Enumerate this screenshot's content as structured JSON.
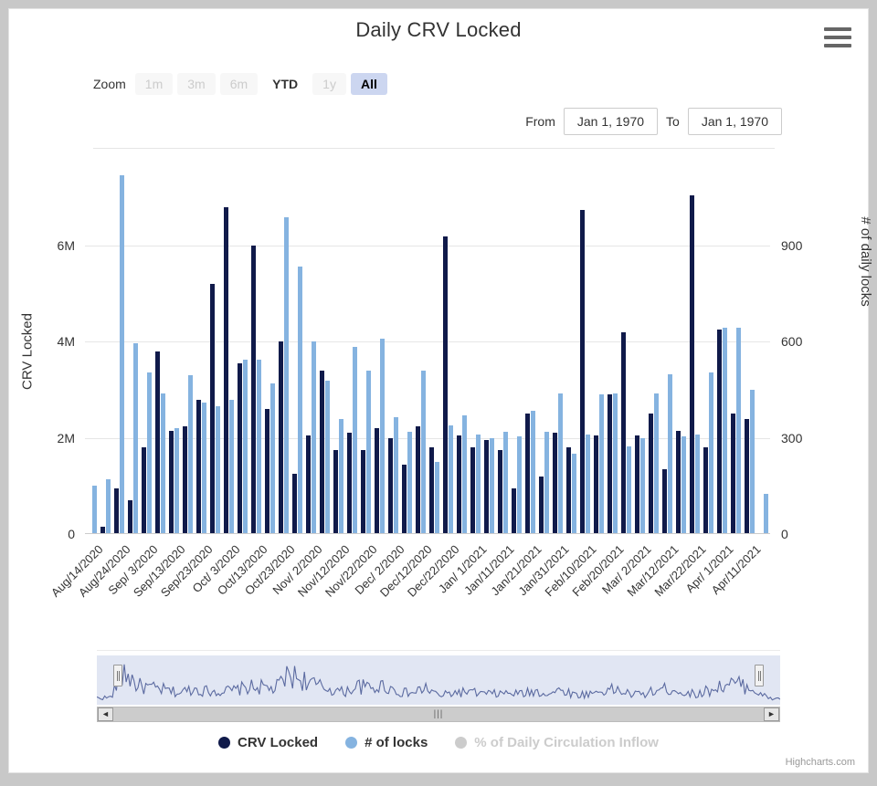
{
  "header": {
    "title": "Daily CRV Locked",
    "menu_icon": "hamburger-menu-icon"
  },
  "rangeselector": {
    "zoom_label": "Zoom",
    "buttons": [
      {
        "label": "1m",
        "state": "disabled"
      },
      {
        "label": "3m",
        "state": "disabled"
      },
      {
        "label": "6m",
        "state": "disabled"
      },
      {
        "label": "YTD",
        "state": "enabled"
      },
      {
        "label": "1y",
        "state": "disabled"
      },
      {
        "label": "All",
        "state": "selected"
      }
    ],
    "from_label": "From",
    "from_value": "Jan 1, 1970",
    "to_label": "To",
    "to_value": "Jan 1, 1970"
  },
  "navigator": {
    "scroll_left_arrow": "◄",
    "scroll_right_arrow": "►",
    "thumb_grip": "|||"
  },
  "credits": "Highcharts.com",
  "colors": {
    "crv_locked": "#101a4a",
    "num_locks": "#85b3e0",
    "inflow_disabled": "#cccccc",
    "selected_button_bg": "#ccd6f0",
    "gridline": "#e6e6e6"
  },
  "chart_data": {
    "type": "bar",
    "title": "Daily CRV Locked",
    "xlabel": "",
    "ylabel": "CRV Locked",
    "ylabel_right": "# of daily locks",
    "grid": true,
    "legend_position": "bottom",
    "ylim": [
      0,
      7600000
    ],
    "ylim_right": [
      0,
      1140
    ],
    "yticks": [
      "0",
      "2M",
      "4M",
      "6M"
    ],
    "ytick_values": [
      0,
      2000000,
      4000000,
      6000000
    ],
    "yticks_right": [
      "0",
      "300",
      "600",
      "900"
    ],
    "ytick_values_right": [
      0,
      300,
      600,
      900
    ],
    "categories": [
      "Aug/14/2020",
      "Aug/24/2020",
      "Sep/ 3/2020",
      "Sep/13/2020",
      "Sep/23/2020",
      "Oct/ 3/2020",
      "Oct/13/2020",
      "Oct/23/2020",
      "Nov/ 2/2020",
      "Nov/12/2020",
      "Nov/22/2020",
      "Dec/ 2/2020",
      "Dec/12/2020",
      "Dec/22/2020",
      "Jan/ 1/2021",
      "Jan/11/2021",
      "Jan/21/2021",
      "Jan/31/2021",
      "Feb/10/2021",
      "Feb/20/2021",
      "Mar/ 2/2021",
      "Mar/12/2021",
      "Mar/22/2021",
      "Apr/ 1/2021",
      "Apr/11/2021"
    ],
    "tick_every": 1,
    "series": [
      {
        "name": "CRV Locked",
        "color": "#101a4a",
        "axis": "left",
        "values": [
          0,
          150000,
          950000,
          700000,
          1800000,
          3800000,
          2150000,
          2250000,
          2800000,
          5200000,
          6800000,
          3550000,
          6000000,
          2600000,
          4000000,
          1250000,
          2050000,
          3400000,
          1750000,
          2100000,
          1750000,
          2200000,
          2000000,
          1450000,
          2250000,
          1800000,
          6200000,
          2050000,
          1800000,
          1950000,
          1750000,
          950000,
          2500000,
          1200000,
          2100000,
          1800000,
          6750000,
          2050000,
          2900000,
          4200000,
          2050000,
          2500000,
          1350000,
          2150000,
          7050000,
          1800000,
          4250000,
          2500000,
          2400000,
          0
        ]
      },
      {
        "name": "# of locks",
        "color": "#85b3e0",
        "axis": "right",
        "values": [
          150,
          170,
          1120,
          595,
          505,
          440,
          330,
          495,
          410,
          400,
          420,
          545,
          545,
          470,
          990,
          835,
          600,
          480,
          360,
          585,
          510,
          610,
          365,
          320,
          510,
          225,
          340,
          370,
          310,
          300,
          320,
          305,
          385,
          320,
          440,
          250,
          310,
          435,
          440,
          275,
          300,
          440,
          500,
          305,
          310,
          505,
          645,
          645,
          450,
          125
        ]
      },
      {
        "name": "% of Daily Circulation Inflow",
        "color": "#cccccc",
        "axis": "right",
        "visible": false,
        "values": []
      }
    ],
    "legend": [
      {
        "label": "CRV Locked",
        "color": "#101a4a",
        "active": true
      },
      {
        "label": "# of locks",
        "color": "#85b3e0",
        "active": true
      },
      {
        "label": "% of Daily Circulation Inflow",
        "color": "#cccccc",
        "active": false
      }
    ]
  }
}
